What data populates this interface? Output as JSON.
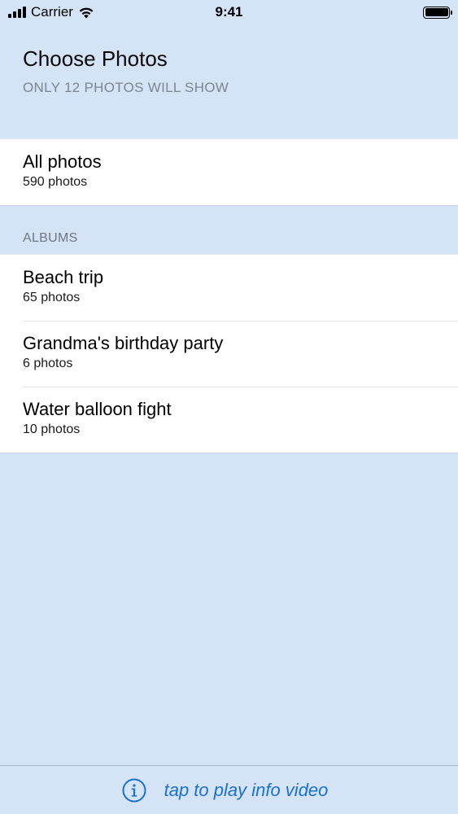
{
  "status_bar": {
    "carrier": "Carrier",
    "time": "9:41"
  },
  "header": {
    "title": "Choose Photos",
    "subtitle": "ONLY 12 PHOTOS WILL SHOW"
  },
  "all_photos": {
    "title": "All photos",
    "count": "590 photos"
  },
  "albums": {
    "section_label": "ALBUMS",
    "items": [
      {
        "title": "Beach trip",
        "count": "65 photos"
      },
      {
        "title": "Grandma's birthday party",
        "count": "6 photos"
      },
      {
        "title": "Water balloon fight",
        "count": "10 photos"
      }
    ]
  },
  "footer": {
    "info_label": "tap to play info video"
  },
  "colors": {
    "background": "#d4e3f5",
    "accent": "#1a6fcf"
  },
  "icons": [
    "cellular-signal-icon",
    "wifi-icon",
    "battery-icon",
    "info-icon"
  ]
}
